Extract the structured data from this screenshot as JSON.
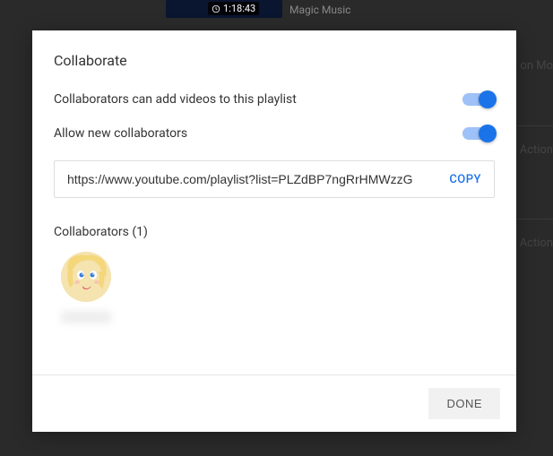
{
  "background": {
    "video_duration": "1:18:43",
    "channel_name": "Magic Music",
    "right_text_1": "on Mo",
    "right_text_2": "i Action",
    "right_text_3": "Action"
  },
  "dialog": {
    "title": "Collaborate",
    "setting_add_videos": "Collaborators can add videos to this playlist",
    "setting_allow_new": "Allow new collaborators",
    "share_url": "https://www.youtube.com/playlist?list=PLZdBP7ngRrHMWzzG",
    "copy_label": "COPY",
    "collaborators_heading": "Collaborators (1)",
    "done_label": "DONE"
  }
}
